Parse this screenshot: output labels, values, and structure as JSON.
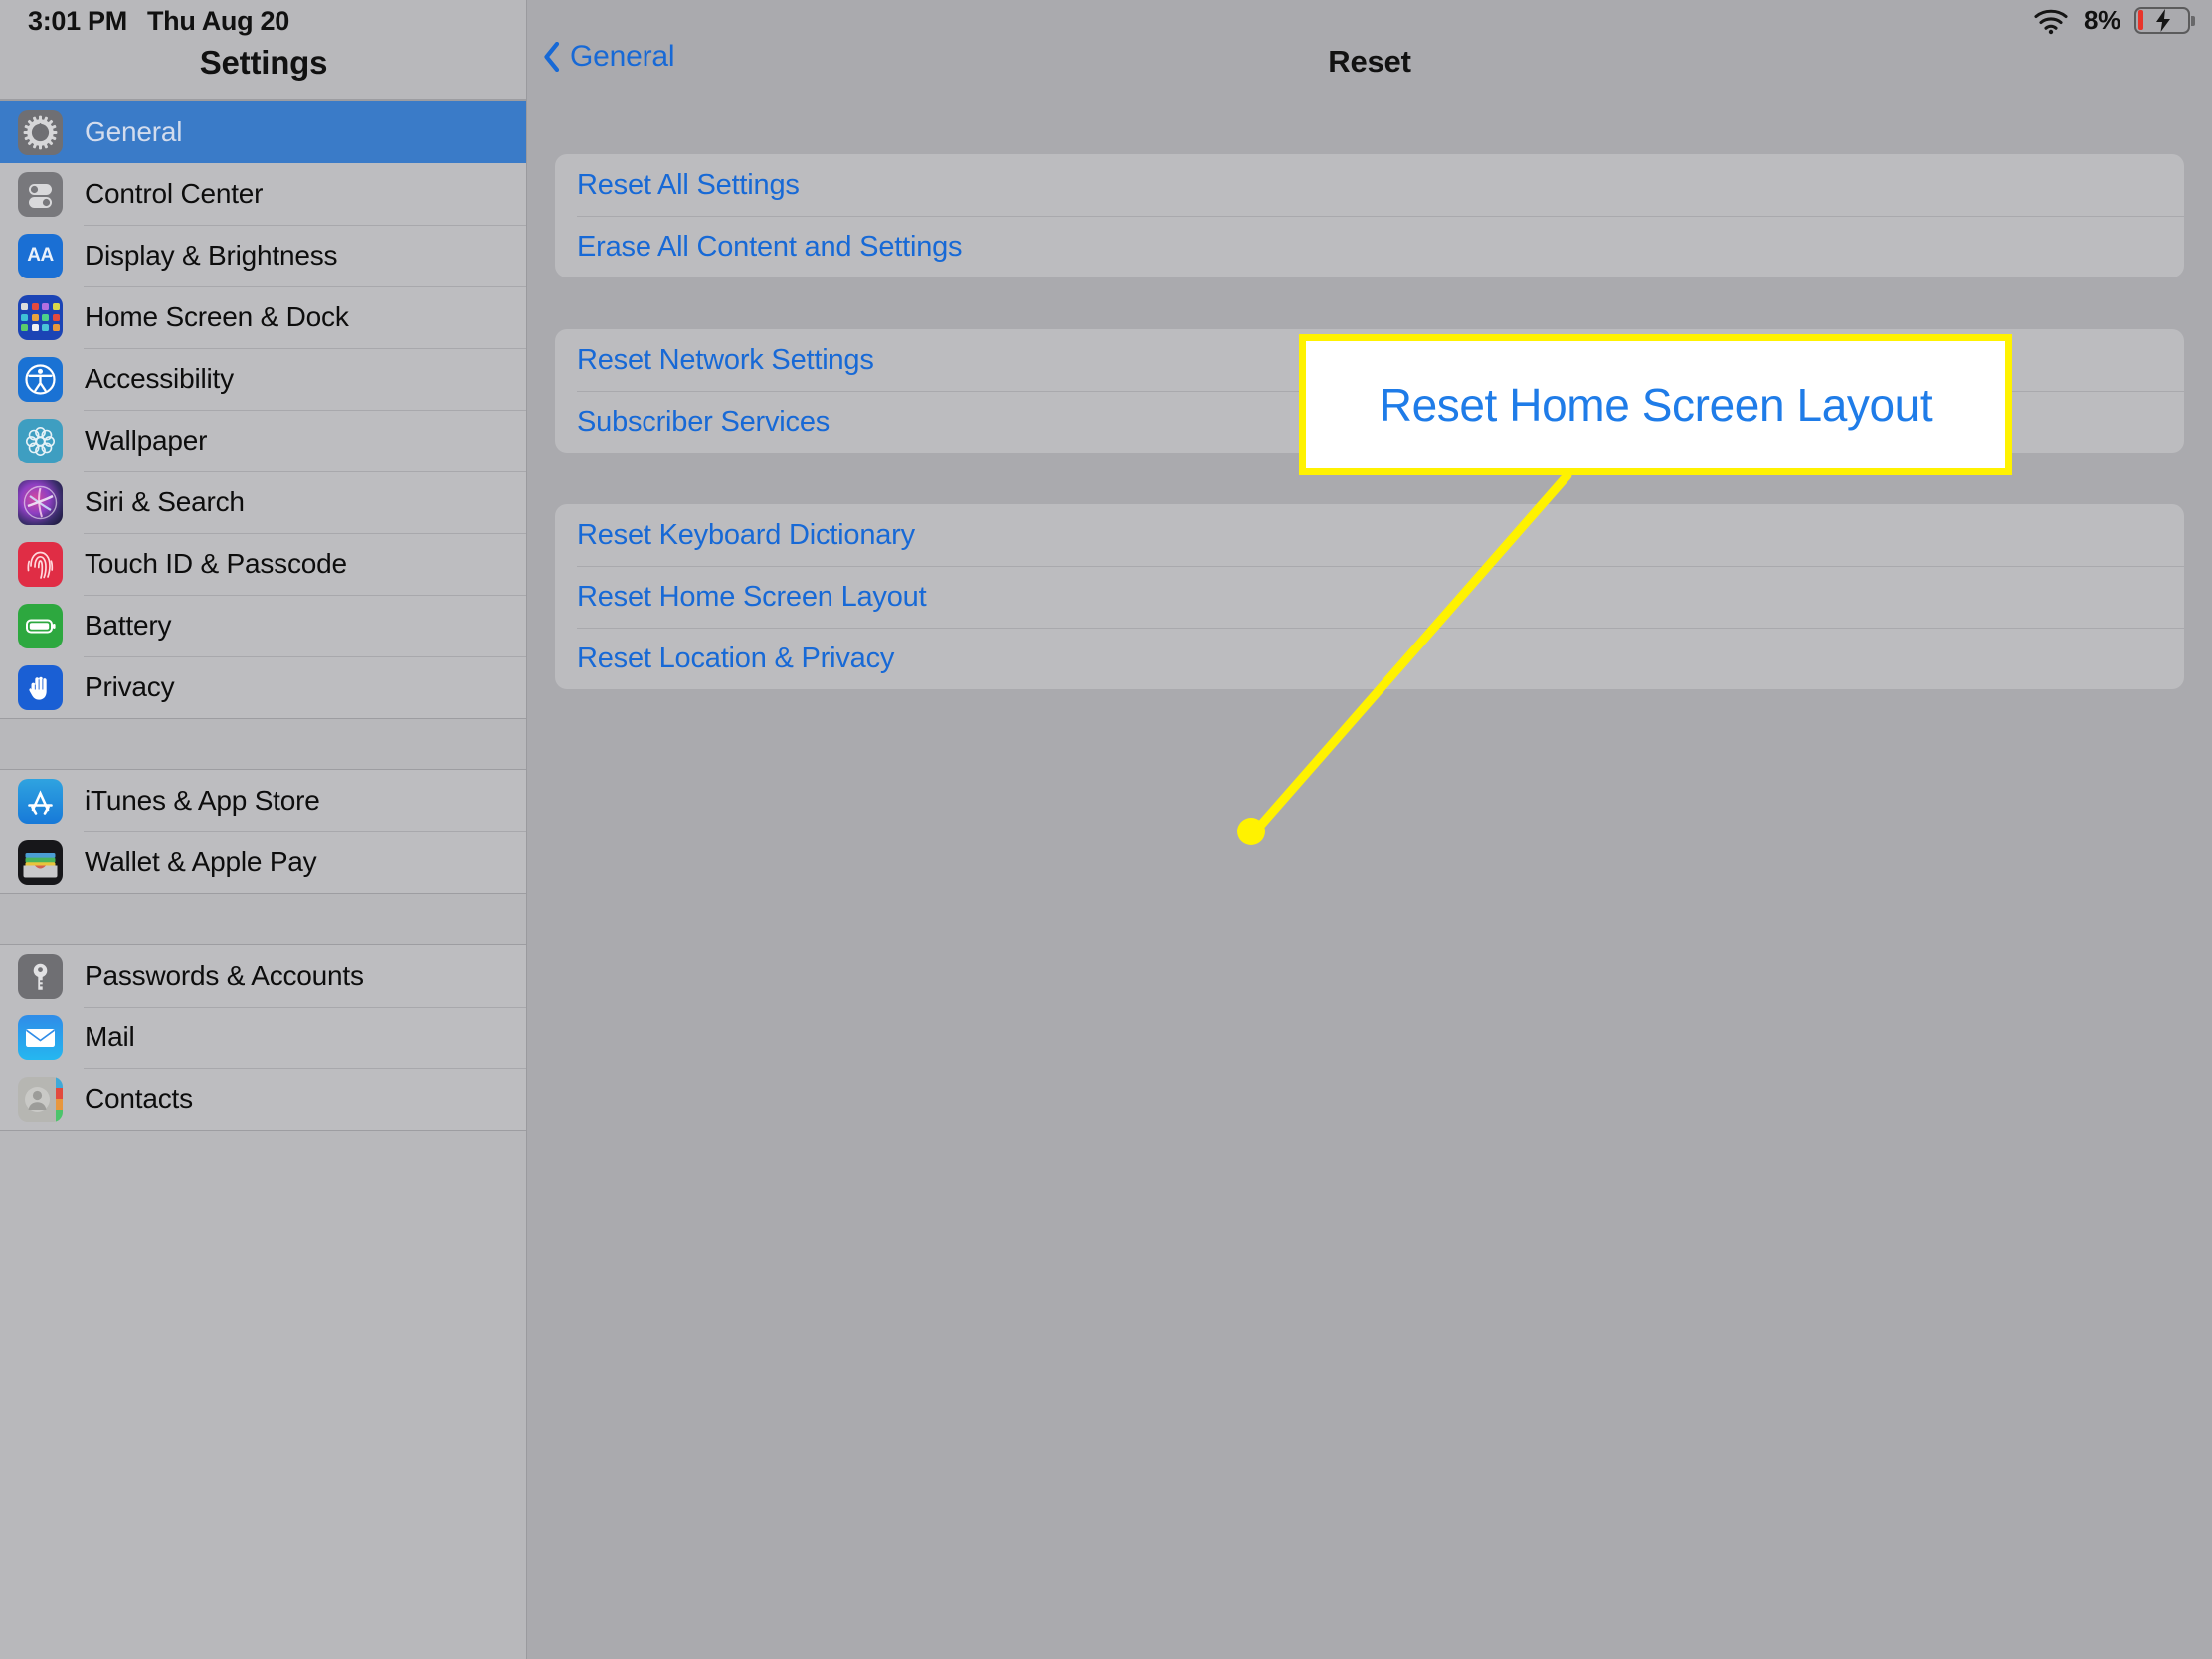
{
  "statusbar": {
    "time": "3:01 PM",
    "date": "Thu Aug 20",
    "wifi_icon": "wifi-icon",
    "battery_percent": "8%",
    "battery_icon": "battery-charging-icon",
    "battery_level_color": "#e8342a"
  },
  "sidebar": {
    "title": "Settings",
    "selected_item": "General",
    "selected_color": "#3a7bc8",
    "groups": [
      {
        "items": [
          {
            "label": "General",
            "icon": "gear-icon",
            "icon_color": "#6f6f73",
            "selected": true
          },
          {
            "label": "Control Center",
            "icon": "toggles-icon",
            "icon_color": "#78787c",
            "selected": false
          },
          {
            "label": "Display & Brightness",
            "icon": "aa-text-size-icon",
            "icon_color": "#1a6fd4",
            "selected": false
          },
          {
            "label": "Home Screen & Dock",
            "icon": "app-grid-icon",
            "icon_color": "#1b44b5",
            "selected": false
          },
          {
            "label": "Accessibility",
            "icon": "accessibility-person-icon",
            "icon_color": "#1a72d4",
            "selected": false
          },
          {
            "label": "Wallpaper",
            "icon": "flower-icon",
            "icon_color": "#3e9ec1",
            "selected": false
          },
          {
            "label": "Siri & Search",
            "icon": "siri-orb-icon",
            "icon_color": "#8d3fc2",
            "selected": false
          },
          {
            "label": "Touch ID & Passcode",
            "icon": "fingerprint-icon",
            "icon_color": "#e02d45",
            "selected": false
          },
          {
            "label": "Battery",
            "icon": "battery-icon",
            "icon_color": "#2da83f",
            "selected": false
          },
          {
            "label": "Privacy",
            "icon": "hand-icon",
            "icon_color": "#1a5fd4",
            "selected": false
          }
        ]
      },
      {
        "items": [
          {
            "label": "iTunes & App Store",
            "icon": "app-store-icon",
            "icon_color": "#1779d8",
            "selected": false
          },
          {
            "label": "Wallet & Apple Pay",
            "icon": "wallet-icon",
            "icon_color": "#17171a",
            "selected": false
          }
        ]
      },
      {
        "items": [
          {
            "label": "Passwords & Accounts",
            "icon": "key-icon",
            "icon_color": "#6f6f73",
            "selected": false
          },
          {
            "label": "Mail",
            "icon": "envelope-icon",
            "icon_color": "#2f8ce8",
            "selected": false
          },
          {
            "label": "Contacts",
            "icon": "contact-person-icon",
            "icon_color": "#b6b6b2",
            "selected": false
          }
        ]
      }
    ]
  },
  "detail": {
    "back_label": "General",
    "back_icon": "chevron-left-icon",
    "title": "Reset",
    "link_color": "#1769d6",
    "groups": [
      {
        "items": [
          {
            "label": "Reset All Settings"
          },
          {
            "label": "Erase All Content and Settings"
          }
        ]
      },
      {
        "items": [
          {
            "label": "Reset Network Settings"
          },
          {
            "label": "Subscriber Services"
          }
        ]
      },
      {
        "items": [
          {
            "label": "Reset Keyboard Dictionary"
          },
          {
            "label": "Reset Home Screen Layout"
          },
          {
            "label": "Reset Location & Privacy"
          }
        ]
      }
    ]
  },
  "annotation": {
    "callout_text": "Reset Home Screen Layout",
    "callout_border_color": "#fff200",
    "callout_background": "#ffffff",
    "callout_text_color": "#1f7ce8",
    "leader_line_color": "#fff200",
    "marker_dot_color": "#fff200"
  }
}
